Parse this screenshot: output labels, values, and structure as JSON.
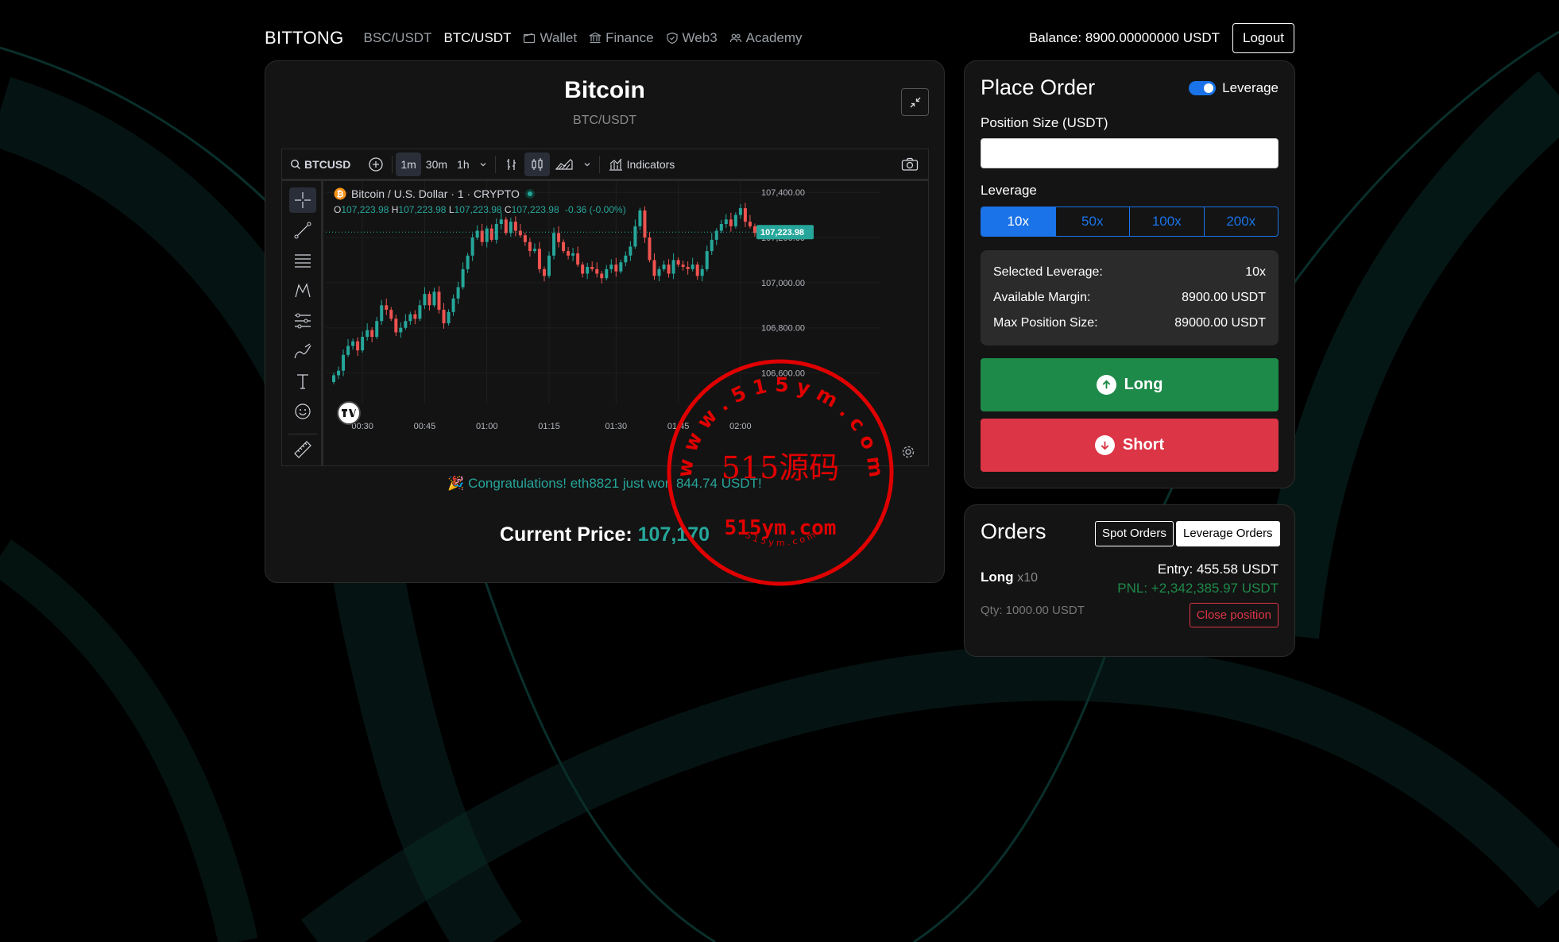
{
  "nav": {
    "brand": "BITTONG",
    "links": [
      "BSC/USDT",
      "BTC/USDT",
      "Wallet",
      "Finance",
      "Web3",
      "Academy"
    ],
    "active": "BTC/USDT",
    "balance": "Balance: 8900.00000000 USDT",
    "logout": "Logout"
  },
  "chart_panel": {
    "title": "Bitcoin",
    "pair": "BTC/USDT",
    "congrats": "🎉 Congratulations! eth8821 just won 844.74 USDT!",
    "current_price_label": "Current Price:",
    "current_price_value": "107,170"
  },
  "tradingview": {
    "symbol": "BTCUSD",
    "intervals": [
      "1m",
      "30m",
      "1h"
    ],
    "selected_interval": "1m",
    "indicators": "Indicators",
    "legend_title": "Bitcoin / U.S. Dollar · 1 · CRYPTO",
    "ohlc": {
      "o": "107,223.98",
      "h": "107,223.98",
      "l": "107,223.98",
      "c": "107,223.98",
      "chg": "-0.36 (-0.00%)"
    },
    "price_tag": "107,223.98"
  },
  "chart_data": {
    "type": "candlestick",
    "x_ticks": [
      "00:30",
      "00:45",
      "01:00",
      "01:15",
      "01:30",
      "01:45",
      "02:00"
    ],
    "y_ticks": [
      "107,400.00",
      "107,200.00",
      "107,000.00",
      "106,800.00",
      "106,600.00"
    ],
    "ylim": [
      106500,
      107450
    ],
    "last_price": 107223.98,
    "closes": [
      106590,
      106610,
      106680,
      106720,
      106740,
      106700,
      106760,
      106790,
      106760,
      106830,
      106900,
      106880,
      106840,
      106780,
      106800,
      106830,
      106860,
      106840,
      106900,
      106950,
      106900,
      106960,
      106880,
      106820,
      106870,
      106930,
      106980,
      107060,
      107120,
      107200,
      107230,
      107180,
      107240,
      107190,
      107260,
      107280,
      107220,
      107270,
      107230,
      107210,
      107180,
      107140,
      107150,
      107060,
      107030,
      107120,
      107220,
      107180,
      107140,
      107120,
      107130,
      107080,
      107040,
      107070,
      107060,
      107040,
      107020,
      107060,
      107080,
      107050,
      107090,
      107120,
      107160,
      107250,
      107320,
      107200,
      107100,
      107030,
      107060,
      107080,
      107040,
      107100,
      107080,
      107070,
      107060,
      107080,
      107030,
      107060,
      107140,
      107190,
      107230,
      107260,
      107280,
      107250,
      107300,
      107330,
      107270,
      107250,
      107220
    ]
  },
  "order": {
    "title": "Place Order",
    "leverage_toggle": "Leverage",
    "position_label": "Position Size (USDT)",
    "leverage_label": "Leverage",
    "options": [
      "10x",
      "50x",
      "100x",
      "200x"
    ],
    "selected": "10x",
    "info": [
      {
        "k": "Selected Leverage:",
        "v": "10x"
      },
      {
        "k": "Available Margin:",
        "v": "8900.00 USDT"
      },
      {
        "k": "Max Position Size:",
        "v": "89000.00 USDT"
      }
    ],
    "long": "Long",
    "short": "Short",
    "colors": {
      "long": "#1e8a4a",
      "short": "#dc3545",
      "accent": "#1a73e8"
    }
  },
  "orders": {
    "title": "Orders",
    "tab_spot": "Spot Orders",
    "tab_leverage": "Leverage Orders",
    "side": "Long",
    "lev": "x10",
    "entry": "Entry: 455.58 USDT",
    "pnl": "PNL: +2,342,385.97 USDT",
    "qty": "Qty: 1000.00 USDT",
    "close": "Close position"
  },
  "watermark": {
    "site": "515ym.com",
    "name": "515源码",
    "ring_top": "w w w . 5 1 5 y m . c o m",
    "ring_small": "5 1 5 y m . c o m"
  }
}
